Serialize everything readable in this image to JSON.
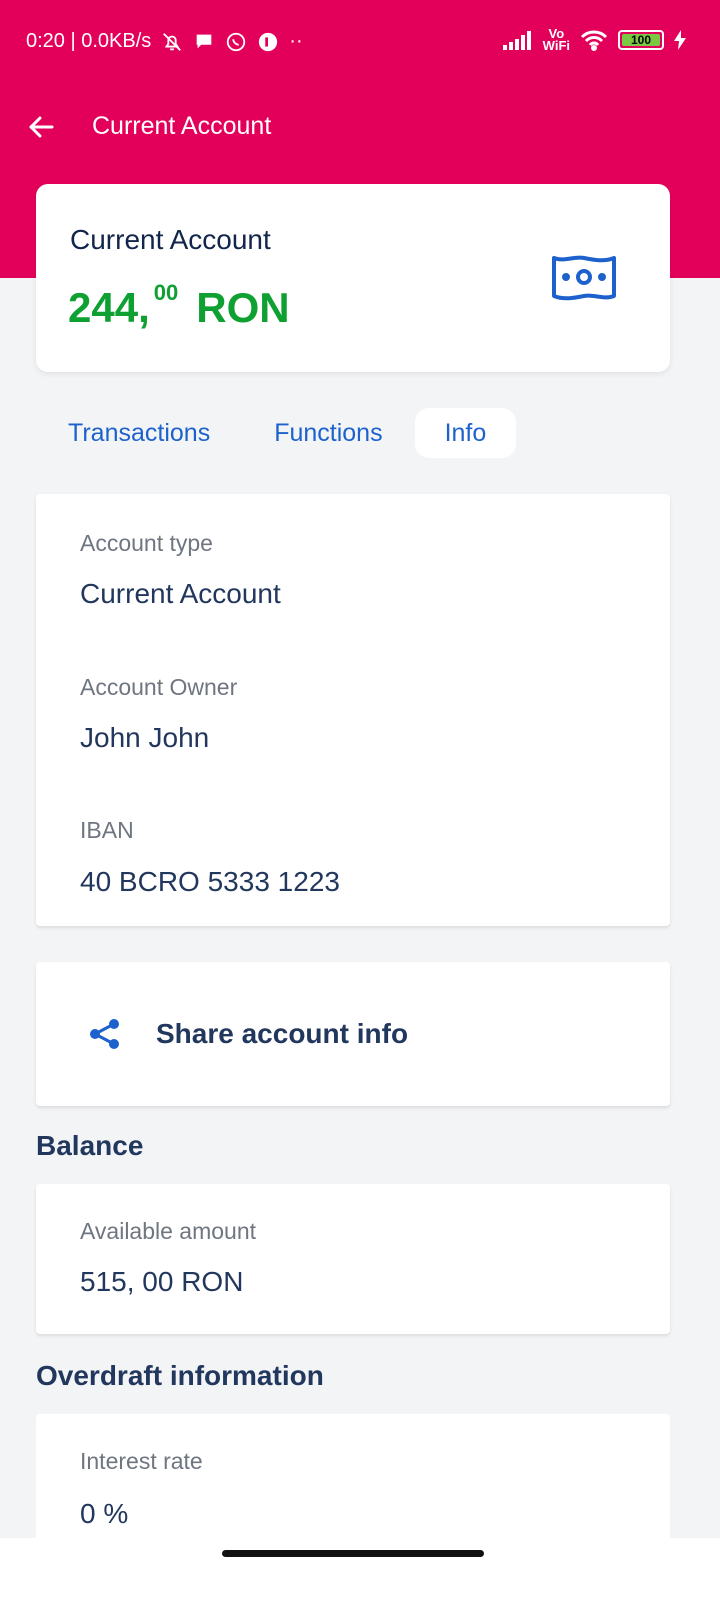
{
  "status_bar": {
    "time_speed": "0:20 | 0.0KB/s",
    "vowifi_top": "Vo",
    "vowifi_bottom": "WiFi",
    "battery": "100",
    "more": "··"
  },
  "header": {
    "title": "Current Account"
  },
  "account_card": {
    "title": "Current Account",
    "balance_int": "244,",
    "balance_dec": "00",
    "currency": "RON"
  },
  "tabs": [
    {
      "label": "Transactions",
      "active": false
    },
    {
      "label": "Functions",
      "active": false
    },
    {
      "label": "Info",
      "active": true
    }
  ],
  "info": {
    "account_type_label": "Account type",
    "account_type_value": "Current Account",
    "owner_label": "Account Owner",
    "owner_value": "John John",
    "iban_label": "IBAN",
    "iban_value": "40 BCRO 5333 1223"
  },
  "share": {
    "label": "Share account info"
  },
  "balance_section": {
    "title": "Balance",
    "available_label": "Available amount",
    "available_value": "515, 00 RON"
  },
  "overdraft_section": {
    "title": "Overdraft information",
    "interest_label": "Interest rate",
    "interest_value": "0 %"
  },
  "colors": {
    "brand": "#e3005a",
    "balance_green": "#0fa032",
    "link_blue": "#1d62cc",
    "text_navy": "#22375d"
  }
}
